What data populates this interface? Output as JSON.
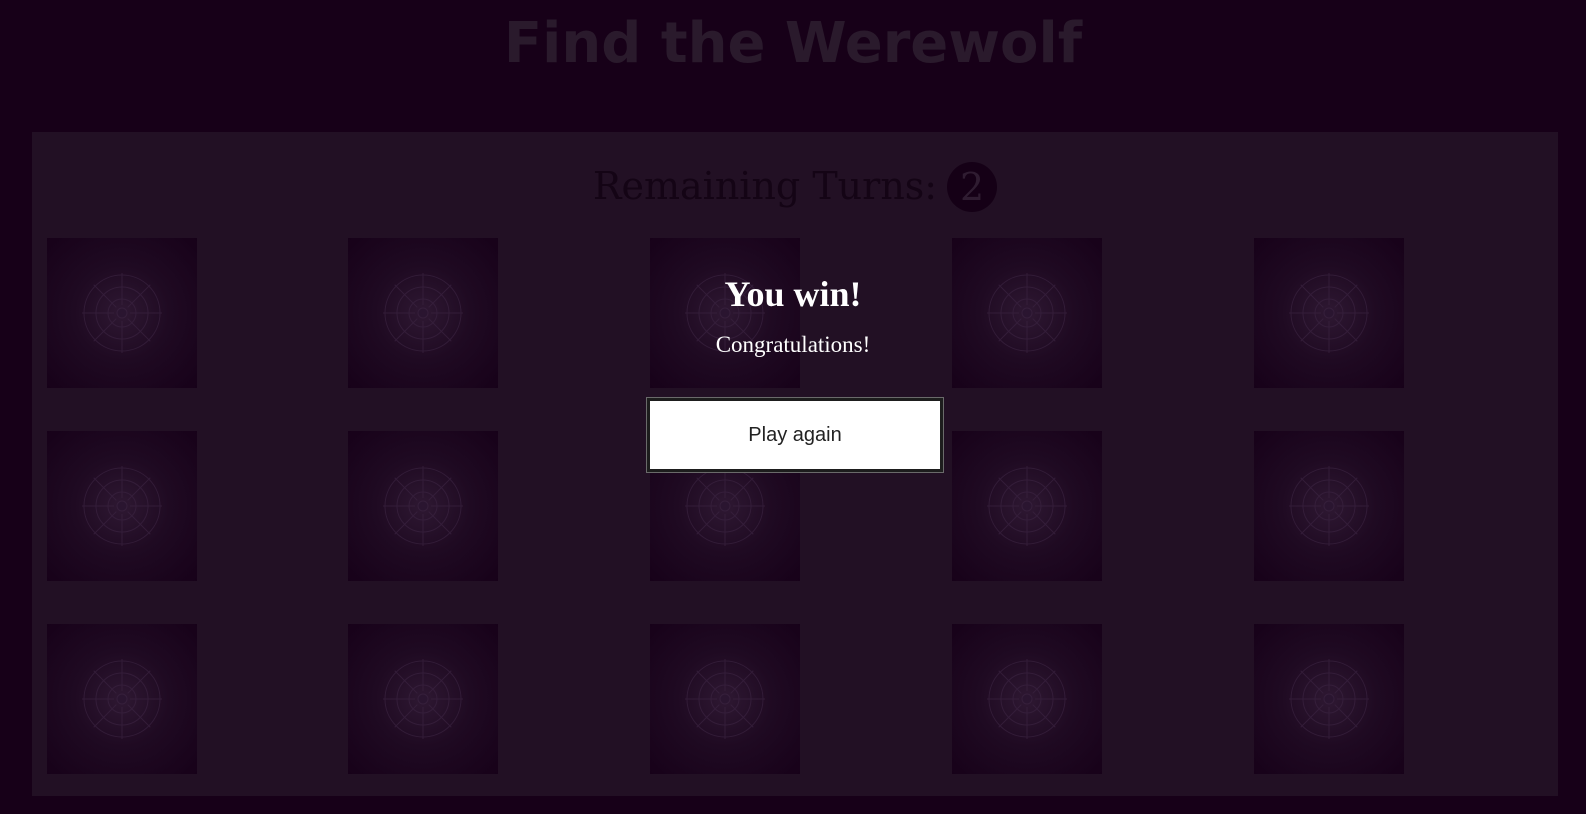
{
  "header": {
    "title": "Find the Werewolf"
  },
  "status": {
    "remaining_label": "Remaining Turns:",
    "remaining_turns": "2"
  },
  "board": {
    "rows": 3,
    "columns": 5,
    "card_icon": "moon-rune-icon"
  },
  "modal": {
    "title": "You win!",
    "message": "Congratulations!",
    "button_label": "Play again"
  },
  "colors": {
    "background": "#170018",
    "board": "#221024",
    "card": "#1f0a22",
    "modal_text": "#ffffff"
  }
}
